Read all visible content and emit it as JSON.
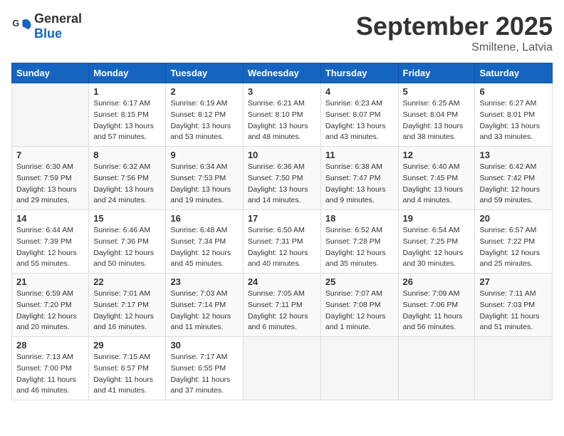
{
  "header": {
    "logo_general": "General",
    "logo_blue": "Blue",
    "month": "September 2025",
    "location": "Smiltene, Latvia"
  },
  "days_of_week": [
    "Sunday",
    "Monday",
    "Tuesday",
    "Wednesday",
    "Thursday",
    "Friday",
    "Saturday"
  ],
  "weeks": [
    [
      {
        "day": "",
        "info": ""
      },
      {
        "day": "1",
        "info": "Sunrise: 6:17 AM\nSunset: 8:15 PM\nDaylight: 13 hours\nand 57 minutes."
      },
      {
        "day": "2",
        "info": "Sunrise: 6:19 AM\nSunset: 8:12 PM\nDaylight: 13 hours\nand 53 minutes."
      },
      {
        "day": "3",
        "info": "Sunrise: 6:21 AM\nSunset: 8:10 PM\nDaylight: 13 hours\nand 48 minutes."
      },
      {
        "day": "4",
        "info": "Sunrise: 6:23 AM\nSunset: 8:07 PM\nDaylight: 13 hours\nand 43 minutes."
      },
      {
        "day": "5",
        "info": "Sunrise: 6:25 AM\nSunset: 8:04 PM\nDaylight: 13 hours\nand 38 minutes."
      },
      {
        "day": "6",
        "info": "Sunrise: 6:27 AM\nSunset: 8:01 PM\nDaylight: 13 hours\nand 33 minutes."
      }
    ],
    [
      {
        "day": "7",
        "info": "Sunrise: 6:30 AM\nSunset: 7:59 PM\nDaylight: 13 hours\nand 29 minutes."
      },
      {
        "day": "8",
        "info": "Sunrise: 6:32 AM\nSunset: 7:56 PM\nDaylight: 13 hours\nand 24 minutes."
      },
      {
        "day": "9",
        "info": "Sunrise: 6:34 AM\nSunset: 7:53 PM\nDaylight: 13 hours\nand 19 minutes."
      },
      {
        "day": "10",
        "info": "Sunrise: 6:36 AM\nSunset: 7:50 PM\nDaylight: 13 hours\nand 14 minutes."
      },
      {
        "day": "11",
        "info": "Sunrise: 6:38 AM\nSunset: 7:47 PM\nDaylight: 13 hours\nand 9 minutes."
      },
      {
        "day": "12",
        "info": "Sunrise: 6:40 AM\nSunset: 7:45 PM\nDaylight: 13 hours\nand 4 minutes."
      },
      {
        "day": "13",
        "info": "Sunrise: 6:42 AM\nSunset: 7:42 PM\nDaylight: 12 hours\nand 59 minutes."
      }
    ],
    [
      {
        "day": "14",
        "info": "Sunrise: 6:44 AM\nSunset: 7:39 PM\nDaylight: 12 hours\nand 55 minutes."
      },
      {
        "day": "15",
        "info": "Sunrise: 6:46 AM\nSunset: 7:36 PM\nDaylight: 12 hours\nand 50 minutes."
      },
      {
        "day": "16",
        "info": "Sunrise: 6:48 AM\nSunset: 7:34 PM\nDaylight: 12 hours\nand 45 minutes."
      },
      {
        "day": "17",
        "info": "Sunrise: 6:50 AM\nSunset: 7:31 PM\nDaylight: 12 hours\nand 40 minutes."
      },
      {
        "day": "18",
        "info": "Sunrise: 6:52 AM\nSunset: 7:28 PM\nDaylight: 12 hours\nand 35 minutes."
      },
      {
        "day": "19",
        "info": "Sunrise: 6:54 AM\nSunset: 7:25 PM\nDaylight: 12 hours\nand 30 minutes."
      },
      {
        "day": "20",
        "info": "Sunrise: 6:57 AM\nSunset: 7:22 PM\nDaylight: 12 hours\nand 25 minutes."
      }
    ],
    [
      {
        "day": "21",
        "info": "Sunrise: 6:59 AM\nSunset: 7:20 PM\nDaylight: 12 hours\nand 20 minutes."
      },
      {
        "day": "22",
        "info": "Sunrise: 7:01 AM\nSunset: 7:17 PM\nDaylight: 12 hours\nand 16 minutes."
      },
      {
        "day": "23",
        "info": "Sunrise: 7:03 AM\nSunset: 7:14 PM\nDaylight: 12 hours\nand 11 minutes."
      },
      {
        "day": "24",
        "info": "Sunrise: 7:05 AM\nSunset: 7:11 PM\nDaylight: 12 hours\nand 6 minutes."
      },
      {
        "day": "25",
        "info": "Sunrise: 7:07 AM\nSunset: 7:08 PM\nDaylight: 12 hours\nand 1 minute."
      },
      {
        "day": "26",
        "info": "Sunrise: 7:09 AM\nSunset: 7:06 PM\nDaylight: 11 hours\nand 56 minutes."
      },
      {
        "day": "27",
        "info": "Sunrise: 7:11 AM\nSunset: 7:03 PM\nDaylight: 11 hours\nand 51 minutes."
      }
    ],
    [
      {
        "day": "28",
        "info": "Sunrise: 7:13 AM\nSunset: 7:00 PM\nDaylight: 11 hours\nand 46 minutes."
      },
      {
        "day": "29",
        "info": "Sunrise: 7:15 AM\nSunset: 6:57 PM\nDaylight: 11 hours\nand 41 minutes."
      },
      {
        "day": "30",
        "info": "Sunrise: 7:17 AM\nSunset: 6:55 PM\nDaylight: 11 hours\nand 37 minutes."
      },
      {
        "day": "",
        "info": ""
      },
      {
        "day": "",
        "info": ""
      },
      {
        "day": "",
        "info": ""
      },
      {
        "day": "",
        "info": ""
      }
    ]
  ]
}
